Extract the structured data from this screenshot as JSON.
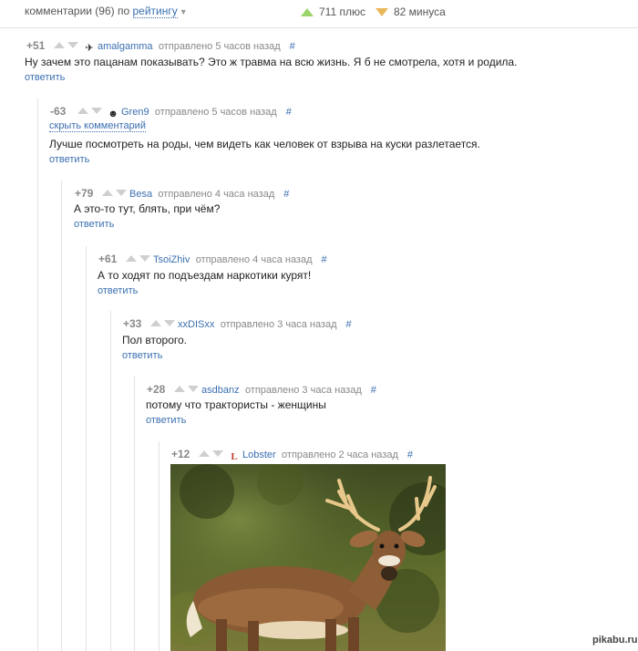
{
  "header": {
    "comments_label": "комментарии (96) по",
    "sort_label": "рейтингу",
    "plus_label": "711 плюс",
    "minus_label": "82 минуса"
  },
  "comments": [
    {
      "rating": "+51",
      "user": "amalgamma",
      "meta": "отправлено 5 часов назад",
      "hash": "#",
      "text": "Ну зачем это пацанам показывать? Это ж травма на всю жизнь. Я б не смотрела, хотя и родила.",
      "reply": "ответить"
    },
    {
      "rating": "-63",
      "user": "Gren9",
      "meta": "отправлено 5 часов назад",
      "hash": "#",
      "hide": "скрыть комментарий",
      "text": "Лучше посмотреть на роды, чем видеть как человек от взрыва на куски разлетается.",
      "reply": "ответить"
    },
    {
      "rating": "+79",
      "user": "Besa",
      "meta": "отправлено 4 часа назад",
      "hash": "#",
      "text": "А это-то тут, блять, при чём?",
      "reply": "ответить"
    },
    {
      "rating": "+61",
      "user": "TsoiZhiv",
      "meta": "отправлено 4 часа назад",
      "hash": "#",
      "text": "А то ходят по подъездам наркотики курят!",
      "reply": "ответить"
    },
    {
      "rating": "+33",
      "user": "xxDISxx",
      "meta": "отправлено 3 часа назад",
      "hash": "#",
      "text": "Пол второго.",
      "reply": "ответить"
    },
    {
      "rating": "+28",
      "user": "asdbanz",
      "meta": "отправлено 3 часа назад",
      "hash": "#",
      "text": "потому что трактористы - женщины",
      "reply": "ответить"
    },
    {
      "rating": "+12",
      "user": "Lobster",
      "meta": "отправлено 2 часа назад",
      "hash": "#"
    }
  ],
  "image": {
    "subject": "white-tailed deer buck in field"
  },
  "watermark": "pikabu.ru",
  "colors": {
    "link": "#3a6fb0",
    "plus": "#9cd36b",
    "minus": "#e9b85a"
  }
}
